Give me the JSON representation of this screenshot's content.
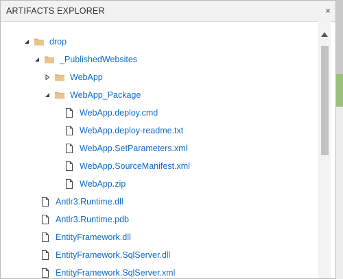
{
  "dialog": {
    "title": "ARTIFACTS EXPLORER",
    "close_glyph": "×"
  },
  "tree": [
    {
      "label": "drop",
      "kind": "folder",
      "expanded": true
    },
    {
      "label": "_PublishedWebsites",
      "kind": "folder",
      "expanded": true
    },
    {
      "label": "WebApp",
      "kind": "folder",
      "expanded": false
    },
    {
      "label": "WebApp_Package",
      "kind": "folder",
      "expanded": true
    },
    {
      "label": "WebApp.deploy.cmd",
      "kind": "file"
    },
    {
      "label": "WebApp.deploy-readme.txt",
      "kind": "file"
    },
    {
      "label": "WebApp.SetParameters.xml",
      "kind": "file"
    },
    {
      "label": "WebApp.SourceManifest.xml",
      "kind": "file"
    },
    {
      "label": "WebApp.zip",
      "kind": "file"
    },
    {
      "label": "Antlr3.Runtime.dll",
      "kind": "file"
    },
    {
      "label": "Antlr3.Runtime.pdb",
      "kind": "file"
    },
    {
      "label": "EntityFramework.dll",
      "kind": "file"
    },
    {
      "label": "EntityFramework.SqlServer.dll",
      "kind": "file"
    },
    {
      "label": "EntityFramework.SqlServer.xml",
      "kind": "file"
    }
  ],
  "icons": {
    "folder": "folder-icon",
    "file": "file-icon",
    "expanded": "triangle-expanded-icon",
    "collapsed": "triangle-collapsed-icon"
  },
  "colors": {
    "link": "#0e6ac8",
    "folder": "#dcb67a",
    "titlebar": "#f2f2f2"
  }
}
